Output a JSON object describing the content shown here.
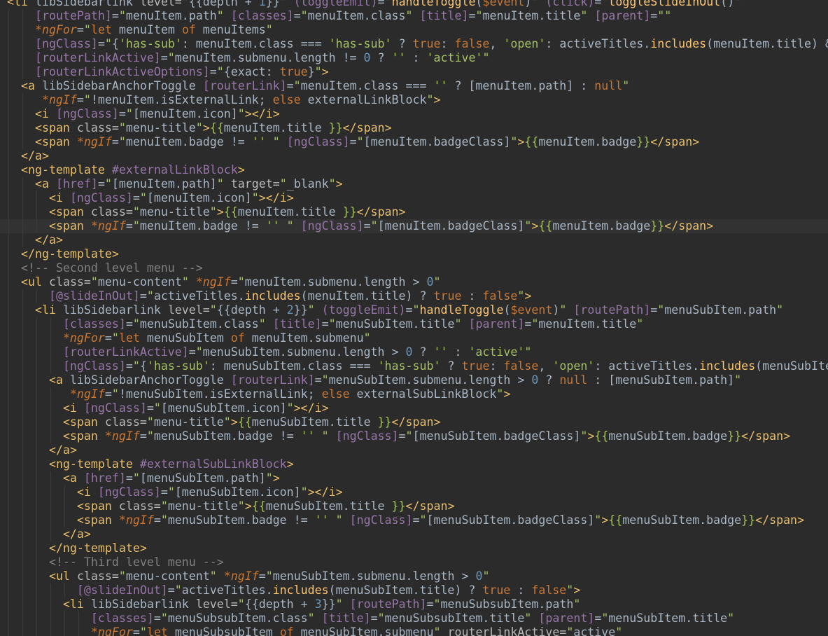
{
  "editor": {
    "language": "angular-html",
    "colors": {
      "background": "#2b2b2b",
      "tag": "#e8bf6a",
      "attribute": "#bababa",
      "directive": "#9876aa",
      "string": "#a5c261",
      "keyword": "#cc7832",
      "comment": "#808080",
      "function": "#ffc66d",
      "number": "#6897bb",
      "default": "#a9b7c6"
    },
    "current_line_index": 16,
    "lines": [
      "<li libSidebarlink level=\"{{depth + 1}}\" (toggleEmit)=\"handleToggle($event)\" (click)=\"toggleSlideInOut()\"",
      "    [routePath]=\"menuItem.path\" [classes]=\"menuItem.class\" [title]=\"menuItem.title\" [parent]=\"\"",
      "    *ngFor=\"let menuItem of menuItems\"",
      "    [ngClass]=\"{'has-sub': menuItem.class === 'has-sub' ? true: false, 'open': activeTitles.includes(menuItem.title) &",
      "    [routerLinkActive]=\"menuItem.submenu.length != 0 ? '' : 'active'\"",
      "    [routerLinkActiveOptions]=\"{exact: true}\">",
      "  <a libSidebarAnchorToggle [routerLink]=\"menuItem.class === '' ? [menuItem.path] : null\"",
      "     *ngIf=\"!menuItem.isExternalLink; else externalLinkBlock\">",
      "    <i [ngClass]=\"[menuItem.icon]\"></i>",
      "    <span class=\"menu-title\">{{menuItem.title }}</span>",
      "    <span *ngIf=\"menuItem.badge != '' \" [ngClass]=\"[menuItem.badgeClass]\">{{menuItem.badge}}</span>",
      "  </a>",
      "  <ng-template #externalLinkBlock>",
      "    <a [href]=\"[menuItem.path]\" target=\"_blank\">",
      "      <i [ngClass]=\"[menuItem.icon]\"></i>",
      "      <span class=\"menu-title\">{{menuItem.title }}</span>",
      "      <span *ngIf=\"menuItem.badge != '' \" [ngClass]=\"[menuItem.badgeClass]\">{{menuItem.badge}}</span>",
      "    </a>",
      "  </ng-template>",
      "  <!-- Second level menu -->",
      "  <ul class=\"menu-content\" *ngIf=\"menuItem.submenu.length > 0\"",
      "      [@slideInOut]=\"activeTitles.includes(menuItem.title) ? true : false\">",
      "    <li libSidebarlink level=\"{{depth + 2}}\" (toggleEmit)=\"handleToggle($event)\" [routePath]=\"menuSubItem.path\"",
      "        [classes]=\"menuSubItem.class\" [title]=\"menuSubItem.title\" [parent]=\"menuItem.title\"",
      "        *ngFor=\"let menuSubItem of menuItem.submenu\"",
      "        [routerLinkActive]=\"menuSubItem.submenu.length > 0 ? '' : 'active'\"",
      "        [ngClass]=\"{'has-sub': menuSubItem.class === 'has-sub' ? true: false, 'open': activeTitles.includes(menuSubIte",
      "      <a libSidebarAnchorToggle [routerLink]=\"menuSubItem.submenu.length > 0 ? null : [menuSubItem.path]\"",
      "         *ngIf=\"!menuSubItem.isExternalLink; else externalSubLinkBlock\">",
      "        <i [ngClass]=\"[menuSubItem.icon]\"></i>",
      "        <span class=\"menu-title\">{{menuSubItem.title }}</span>",
      "        <span *ngIf=\"menuSubItem.badge != '' \" [ngClass]=\"[menuSubItem.badgeClass]\">{{menuSubItem.badge}}</span>",
      "      </a>",
      "      <ng-template #externalSubLinkBlock>",
      "        <a [href]=\"[menuSubItem.path]\">",
      "          <i [ngClass]=\"[menuSubItem.icon]\"></i>",
      "          <span class=\"menu-title\">{{menuSubItem.title }}</span>",
      "          <span *ngIf=\"menuSubItem.badge != '' \" [ngClass]=\"[menuSubItem.badgeClass]\">{{menuSubItem.badge}}</span>",
      "        </a>",
      "      </ng-template>",
      "      <!-- Third level menu -->",
      "      <ul class=\"menu-content\" *ngIf=\"menuSubItem.submenu.length > 0\"",
      "          [@slideInOut]=\"activeTitles.includes(menuSubItem.title) ? true : false\">",
      "        <li libSidebarlink level=\"{{depth + 3}}\" [routePath]=\"menuSubsubItem.path\"",
      "            [classes]=\"menuSubsubItem.class\" [title]=\"menuSubsubItem.title\" [parent]=\"menuSubItem.title\"",
      "            *ngFor=\"let menuSubsubItem of menuSubItem.submenu\" routerLinkActive=\"active\""
    ]
  }
}
